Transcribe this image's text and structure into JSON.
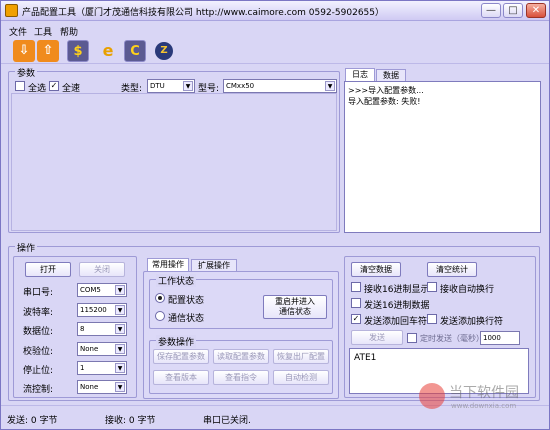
{
  "window": {
    "title": "产品配置工具（厦门才茂通信科技有限公司 http://www.caimore.com 0592-5902655）",
    "minimize": "—",
    "maximize": "□",
    "close": "✕"
  },
  "menu": [
    "文件",
    "工具",
    "帮助"
  ],
  "toolbar": {
    "download_icon": "download-icon",
    "upload_icon": "upload-icon",
    "dollar_icon": "dollar-icon",
    "ie_icon": "ie-icon",
    "c_icon": "c-icon",
    "z_icon": "z-icon"
  },
  "params": {
    "group_label": "参数",
    "select_all_label": "全选",
    "select_all_checked": false,
    "full_speed_label": "全速",
    "full_speed_checked": true,
    "type_label": "类型:",
    "type_value": "DTU",
    "model_label": "型号:",
    "model_value": "CMxx50"
  },
  "log": {
    "tabs": [
      "日志",
      "数据"
    ],
    "lines": [
      ">>>导入配置参数...",
      "导入配置参数: 失败!"
    ]
  },
  "ops": {
    "group_label": "操作",
    "open_button": "打开",
    "close_button": "关闭",
    "serial": [
      {
        "label": "串口号:",
        "value": "COM5"
      },
      {
        "label": "波特率:",
        "value": "115200"
      },
      {
        "label": "数据位:",
        "value": "8"
      },
      {
        "label": "校验位:",
        "value": "None"
      },
      {
        "label": "停止位:",
        "value": "1"
      },
      {
        "label": "流控制:",
        "value": "None"
      }
    ],
    "tabs": [
      "常用操作",
      "扩展操作"
    ],
    "work_status_label": "工作状态",
    "config_state_label": "配置状态",
    "comm_state_label": "通信状态",
    "restart_button_line1": "重启并进入",
    "restart_button_line2": "通信状态",
    "param_ops_label": "参数操作",
    "param_buttons": [
      "保存配置参数",
      "读取配置参数",
      "恢复出厂配置",
      "查看版本",
      "查看指令",
      "自动检测"
    ]
  },
  "data_panel": {
    "clear_data_button": "清空数据",
    "clear_stats_button": "清空统计",
    "options": [
      {
        "label": "接收16进制显示",
        "checked": false
      },
      {
        "label": "接收自动换行",
        "checked": false
      },
      {
        "label": "发送16进制数据",
        "checked": false
      },
      {
        "label": "发送添加回车符",
        "checked": true
      },
      {
        "label": "发送添加换行符",
        "checked": false
      }
    ],
    "send_button": "发送",
    "timed_send_label": "定时发送（毫秒）",
    "timed_send_checked": false,
    "interval_value": "1000",
    "send_text": "ATE1"
  },
  "status": {
    "sent": "发送: 0 字节",
    "received": "接收: 0 字节",
    "port_state": "串口已关闭."
  },
  "watermark": {
    "text": "当下软件园",
    "url": "www.downxia.com"
  }
}
